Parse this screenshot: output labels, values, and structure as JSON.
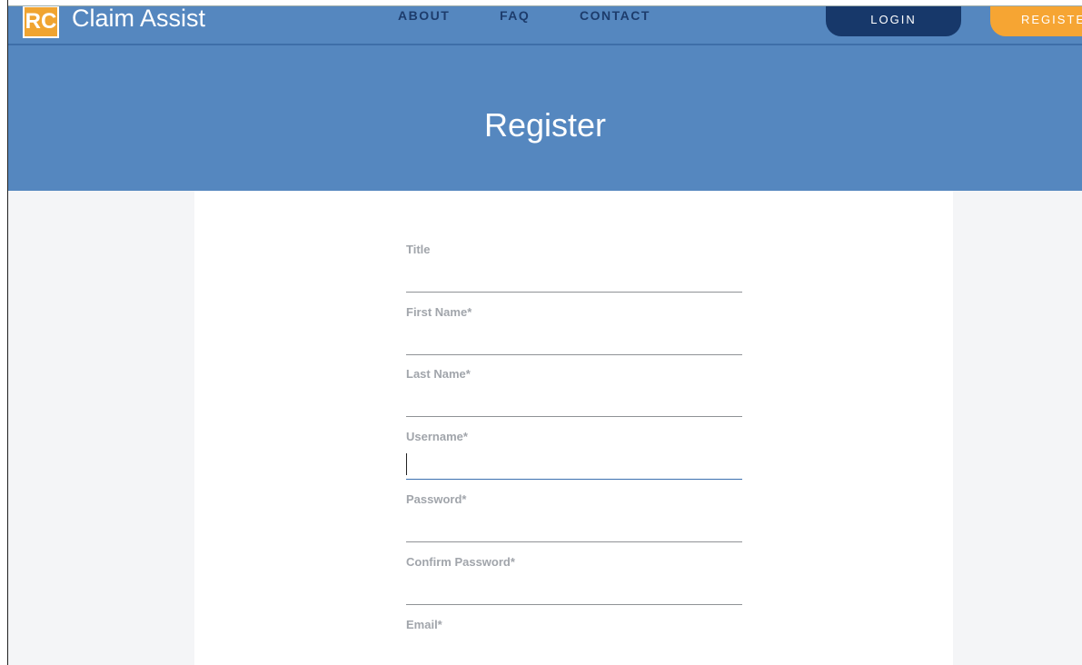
{
  "brand": {
    "logo_letters": "RC",
    "name": "Claim Assist",
    "accent": "#f0a431",
    "primary": "#5587bf"
  },
  "nav": {
    "about": "ABOUT",
    "faq": "FAQ",
    "contact": "CONTACT",
    "login": "LOGIN",
    "register": "REGISTER"
  },
  "page": {
    "title": "Register"
  },
  "form": {
    "fields": [
      {
        "label": "Title",
        "value": ""
      },
      {
        "label": "First Name*",
        "value": ""
      },
      {
        "label": "Last Name*",
        "value": ""
      },
      {
        "label": "Username*",
        "value": ""
      },
      {
        "label": "Password*",
        "value": ""
      },
      {
        "label": "Confirm Password*",
        "value": ""
      },
      {
        "label": "Email*",
        "value": ""
      }
    ]
  }
}
